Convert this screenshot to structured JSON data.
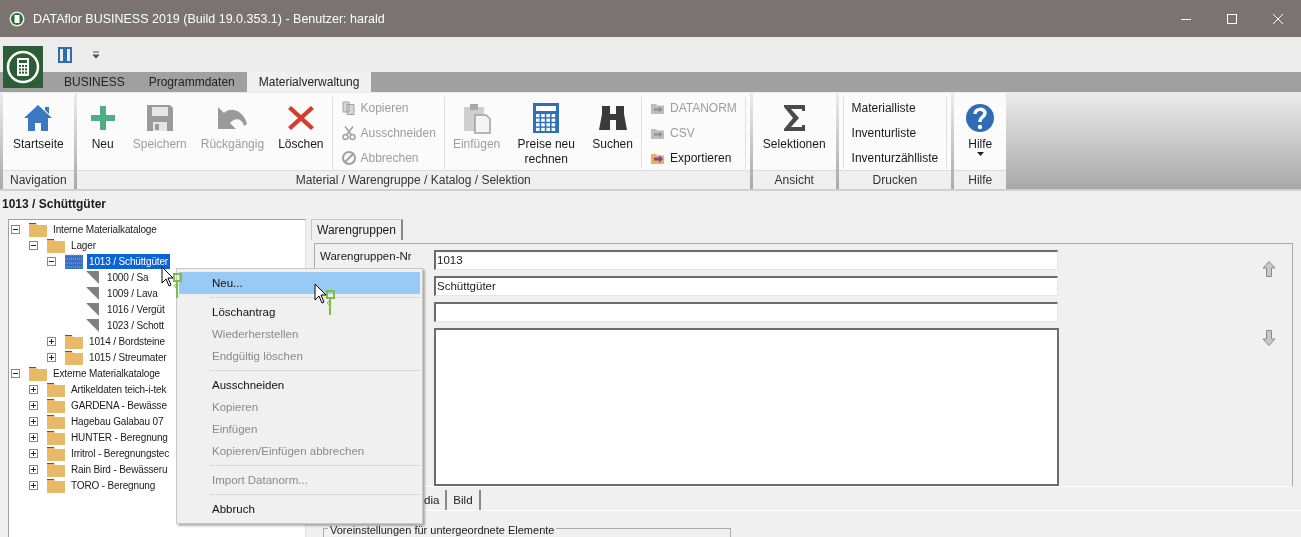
{
  "window": {
    "title": "DATAflor BUSINESS 2019 (Build 19.0.353.1) - Benutzer: harald"
  },
  "ribbon_tabs": [
    {
      "label": "BUSINESS",
      "selected": false
    },
    {
      "label": "Programmdaten",
      "selected": false
    },
    {
      "label": "Materialverwaltung",
      "selected": true
    }
  ],
  "ribbon_groups": [
    {
      "label": "Navigation",
      "items": [
        {
          "kind": "large",
          "label": "Startseite",
          "disabled": false
        }
      ]
    },
    {
      "label": "Material / Warengruppe / Katalog / Selektion",
      "items": [
        {
          "kind": "large",
          "label": "Neu",
          "disabled": false
        },
        {
          "kind": "large",
          "label": "Speichern",
          "disabled": true
        },
        {
          "kind": "large",
          "label": "Rückgängig",
          "disabled": true
        },
        {
          "kind": "large",
          "label": "Löschen",
          "disabled": false
        },
        {
          "kind": "stack",
          "items": [
            {
              "label": "Kopieren",
              "disabled": true
            },
            {
              "label": "Ausschneiden",
              "disabled": true
            },
            {
              "label": "Abbrechen",
              "disabled": true
            }
          ]
        },
        {
          "kind": "large",
          "label": "Einfügen",
          "disabled": true
        },
        {
          "kind": "large",
          "label": "Preise neu rechnen",
          "disabled": false
        },
        {
          "kind": "large",
          "label": "Suchen",
          "disabled": false
        },
        {
          "kind": "stack",
          "items": [
            {
              "label": "DATANORM",
              "disabled": true
            },
            {
              "label": "CSV",
              "disabled": true
            },
            {
              "label": "Exportieren",
              "disabled": false
            }
          ]
        }
      ]
    },
    {
      "label": "Ansicht",
      "items": [
        {
          "kind": "large",
          "label": "Selektionen",
          "disabled": false
        }
      ]
    },
    {
      "label": "Drucken",
      "items": [
        {
          "kind": "stack",
          "items": [
            {
              "label": "Materialliste",
              "disabled": false
            },
            {
              "label": "Inventurliste",
              "disabled": false
            },
            {
              "label": "Inventurzählliste",
              "disabled": false
            }
          ]
        }
      ]
    },
    {
      "label": "Hilfe",
      "items": [
        {
          "kind": "dropdown",
          "label": "Hilfe",
          "disabled": false
        }
      ]
    }
  ],
  "heading": "1013 / Schüttgüter",
  "tree": [
    {
      "label": "Interne Materialkataloge",
      "kind": "folder",
      "selected": false,
      "expanded": true,
      "children": [
        {
          "label": "Lager",
          "kind": "folder",
          "selected": false,
          "expanded": true,
          "children": [
            {
              "label": "1013 / Schüttgüter",
              "kind": "folder",
              "selected": true,
              "expanded": true,
              "children": [
                {
                  "label": "1000 / Sa",
                  "kind": "item",
                  "selected": false
                },
                {
                  "label": "1009 / Lava",
                  "kind": "item",
                  "selected": false
                },
                {
                  "label": "1016 / Vergüt",
                  "kind": "item",
                  "selected": false
                },
                {
                  "label": "1023 / Schott",
                  "kind": "item",
                  "selected": false
                }
              ]
            },
            {
              "label": "1014 / Bordsteine",
              "kind": "folder",
              "selected": false,
              "expanded": false
            },
            {
              "label": "1015 / Streumater",
              "kind": "folder",
              "selected": false,
              "expanded": false
            }
          ]
        }
      ]
    },
    {
      "label": "Externe Materialkataloge",
      "kind": "folder",
      "selected": false,
      "expanded": true,
      "children": [
        {
          "label": "Artikeldaten teich-i-tek",
          "kind": "folder",
          "selected": false,
          "expanded": false
        },
        {
          "label": "GARDENA - Bewässe",
          "kind": "folder",
          "selected": false,
          "expanded": false
        },
        {
          "label": "Hagebau Galabau 07",
          "kind": "folder",
          "selected": false,
          "expanded": false
        },
        {
          "label": "HUNTER - Beregnung",
          "kind": "folder",
          "selected": false,
          "expanded": false
        },
        {
          "label": "Irritrol - Beregnungstec",
          "kind": "folder",
          "selected": false,
          "expanded": false
        },
        {
          "label": "Rain Bird - Bewässeru",
          "kind": "folder",
          "selected": false,
          "expanded": false
        },
        {
          "label": "TORO - Beregnung",
          "kind": "folder",
          "selected": false,
          "expanded": false
        }
      ]
    }
  ],
  "detail_tabs": [
    {
      "label": "Warengruppen",
      "selected": true
    }
  ],
  "fields": [
    {
      "kind": "line",
      "label": "Warengruppen-Nr",
      "value": "1013"
    },
    {
      "kind": "line",
      "value": "Schüttgüter"
    },
    {
      "kind": "line"
    },
    {
      "kind": "area"
    }
  ],
  "bottom_tabs": [
    {
      "label": "dia",
      "selected": false
    },
    {
      "label": "Bild",
      "selected": false
    }
  ],
  "group_box": {
    "title": "Voreinstellungen für untergeordnete Elemente"
  },
  "context_menu": [
    {
      "kind": "item",
      "label": "Neu...",
      "disabled": false,
      "selected": true
    },
    {
      "kind": "separator"
    },
    {
      "kind": "item",
      "label": "Löschantrag",
      "disabled": false,
      "selected": false
    },
    {
      "kind": "item",
      "label": "Wiederherstellen",
      "disabled": true,
      "selected": false
    },
    {
      "kind": "item",
      "label": "Endgültig löschen",
      "disabled": true,
      "selected": false
    },
    {
      "kind": "separator"
    },
    {
      "kind": "item",
      "label": "Ausschneiden",
      "disabled": false,
      "selected": false
    },
    {
      "kind": "item",
      "label": "Kopieren",
      "disabled": true,
      "selected": false
    },
    {
      "kind": "item",
      "label": "Einfügen",
      "disabled": true,
      "selected": false
    },
    {
      "kind": "item",
      "label": "Kopieren/Einfügen abbrechen",
      "disabled": true,
      "selected": false
    },
    {
      "kind": "separator"
    },
    {
      "kind": "item",
      "label": "Import Datanorm...",
      "disabled": true,
      "selected": false
    },
    {
      "kind": "separator"
    },
    {
      "kind": "item",
      "label": "Abbruch",
      "disabled": false,
      "selected": false
    }
  ]
}
